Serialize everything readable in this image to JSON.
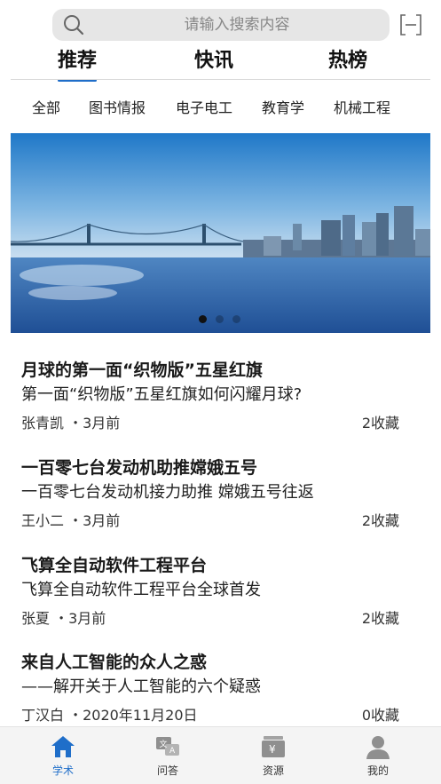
{
  "search": {
    "placeholder": "请输入搜索内容"
  },
  "top_tabs": [
    {
      "label": "推荐",
      "active": true
    },
    {
      "label": "快讯",
      "active": false
    },
    {
      "label": "热榜",
      "active": false
    }
  ],
  "categories": [
    "全部",
    "图书情报",
    "电子电工",
    "教育学",
    "机械工程"
  ],
  "banner": {
    "slides": 3,
    "active_slide": 1
  },
  "articles": [
    {
      "title": "月球的第一面“织物版”五星红旗",
      "subtitle": "第一面“织物版”五星红旗如何闪耀月球?",
      "meta": "张青凯 ・3月前",
      "favorites": "2收藏"
    },
    {
      "title": "一百零七台发动机助推嫦娥五号",
      "subtitle": "一百零七台发动机接力助推 嫦娥五号往返",
      "meta": "王小二 ・3月前",
      "favorites": "2收藏"
    },
    {
      "title": "飞算全自动软件工程平台",
      "subtitle": "飞算全自动软件工程平台全球首发",
      "meta": "张夏 ・3月前",
      "favorites": "2收藏"
    },
    {
      "title": "来自人工智能的众人之惑",
      "subtitle": "——解开关于人工智能的六个疑惑",
      "meta": "丁汉白 ・2020年11月20日",
      "favorites": "0收藏"
    }
  ],
  "bottom_nav": [
    {
      "label": "学术",
      "icon": "home-icon",
      "active": true
    },
    {
      "label": "问答",
      "icon": "qa-icon",
      "active": false
    },
    {
      "label": "资源",
      "icon": "resource-icon",
      "active": false
    },
    {
      "label": "我的",
      "icon": "profile-icon",
      "active": false
    }
  ],
  "colors": {
    "accent": "#1f6ec9",
    "search_bg": "#e6e6e6",
    "nav_bg": "#f4f4f4"
  }
}
